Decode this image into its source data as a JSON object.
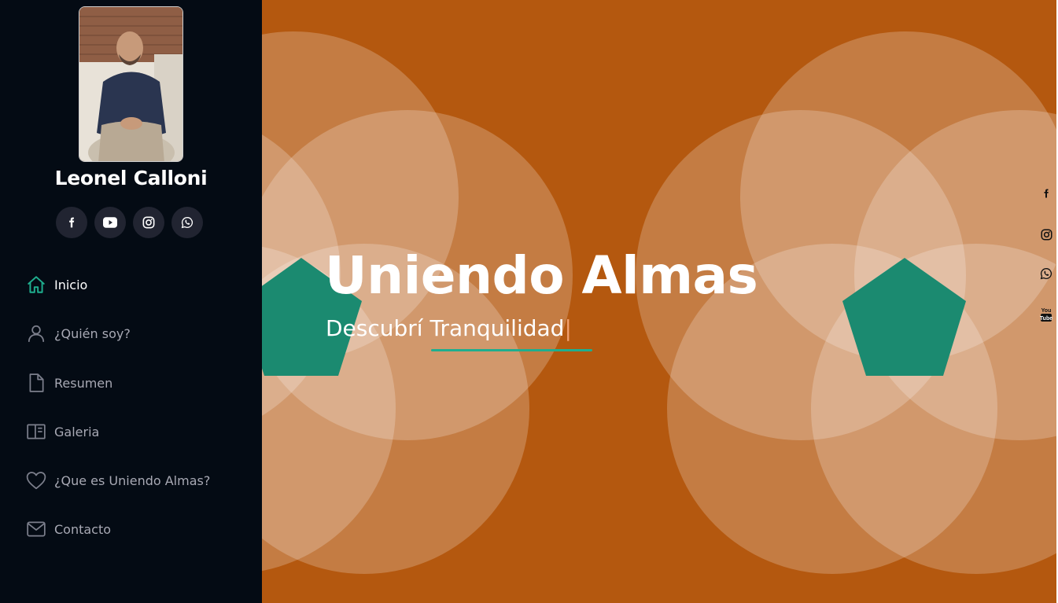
{
  "profile": {
    "name": "Leonel Calloni",
    "photo_alt": "Leonel Calloni"
  },
  "sidebar_social": [
    {
      "icon": "facebook-icon"
    },
    {
      "icon": "youtube-icon"
    },
    {
      "icon": "instagram-icon"
    },
    {
      "icon": "whatsapp-icon"
    }
  ],
  "nav": {
    "items": [
      {
        "label": "Inicio",
        "icon": "home-icon",
        "active": true
      },
      {
        "label": "¿Quién soy?",
        "icon": "person-icon",
        "active": false
      },
      {
        "label": "Resumen",
        "icon": "file-icon",
        "active": false
      },
      {
        "label": "Galeria",
        "icon": "gallery-icon",
        "active": false
      },
      {
        "label": "¿Que es Uniendo Almas?",
        "icon": "heart-icon",
        "active": false
      },
      {
        "label": "Contacto",
        "icon": "envelope-icon",
        "active": false
      }
    ]
  },
  "hero": {
    "title": "Uniendo Almas",
    "subtitle": "Descubrí Tranquilidad",
    "cursor": "|"
  },
  "floating_social": [
    {
      "icon": "facebook-icon"
    },
    {
      "icon": "instagram-icon"
    },
    {
      "icon": "whatsapp-icon"
    },
    {
      "icon": "youtube-icon",
      "label": "You Tube"
    }
  ],
  "colors": {
    "sidebar_bg": "#040b14",
    "hero_bg": "#b4580f",
    "accent_green": "#1fae8e",
    "pentagon": "#1a8a70",
    "nav_text": "#a8a9b4",
    "social_btn_bg": "#212431"
  }
}
